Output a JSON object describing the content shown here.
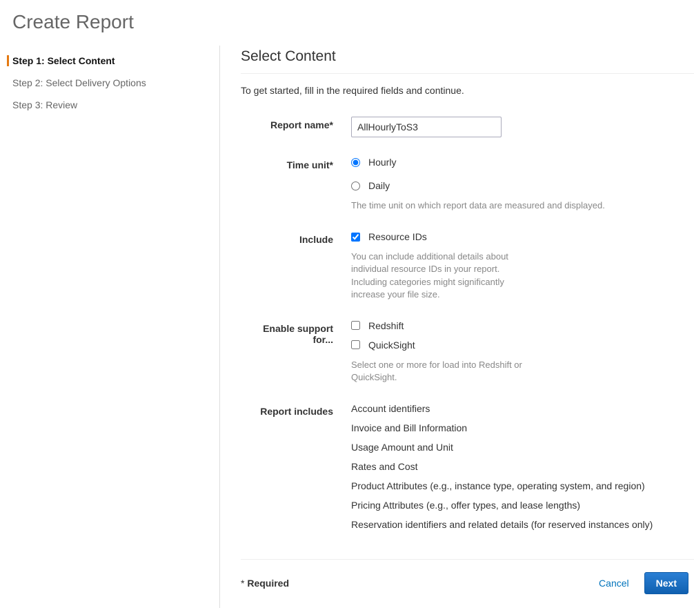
{
  "page": {
    "title": "Create Report"
  },
  "steps": [
    {
      "label": "Step 1: Select Content",
      "active": true
    },
    {
      "label": "Step 2: Select Delivery Options",
      "active": false
    },
    {
      "label": "Step 3: Review",
      "active": false
    }
  ],
  "content": {
    "heading": "Select Content",
    "intro": "To get started, fill in the required fields and continue.",
    "reportName": {
      "label": "Report name*",
      "value": "AllHourlyToS3"
    },
    "timeUnit": {
      "label": "Time unit*",
      "options": {
        "hourly": "Hourly",
        "daily": "Daily"
      },
      "help": "The time unit on which report data are measured and displayed."
    },
    "include": {
      "label": "Include",
      "resourceIds": "Resource IDs",
      "help": "You can include additional details about individual resource IDs in your report. Including categories might significantly increase your file size."
    },
    "enableSupport": {
      "label": "Enable support for...",
      "redshift": "Redshift",
      "quicksight": "QuickSight",
      "help": "Select one or more for load into Redshift or QuickSight."
    },
    "reportIncludes": {
      "label": "Report includes",
      "items": [
        "Account identifiers",
        "Invoice and Bill Information",
        "Usage Amount and Unit",
        "Rates and Cost",
        "Product Attributes (e.g., instance type, operating system, and region)",
        "Pricing Attributes (e.g., offer types, and lease lengths)",
        "Reservation identifiers and related details (for reserved instances only)"
      ]
    },
    "footer": {
      "requiredStar": "* ",
      "requiredLabel": "Required",
      "cancel": "Cancel",
      "next": "Next"
    }
  }
}
